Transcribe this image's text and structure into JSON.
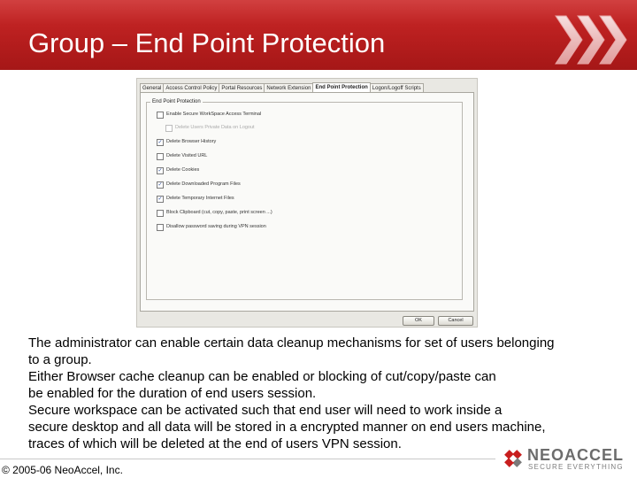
{
  "slide": {
    "title": "Group – End Point Protection",
    "accent_color": "#b71e1e"
  },
  "dialog": {
    "tabs": [
      {
        "label": "General",
        "active": false
      },
      {
        "label": "Access Control Policy",
        "active": false
      },
      {
        "label": "Portal Resources",
        "active": false
      },
      {
        "label": "Network Extension",
        "active": false
      },
      {
        "label": "End Point Protection",
        "active": true
      },
      {
        "label": "Logon/Logoff Scripts",
        "active": false
      }
    ],
    "group_title": "End Point Protection",
    "options": [
      {
        "label": "Enable Secure WorkSpace Access Terminal",
        "checked": false
      },
      {
        "label": "Delete Users Private Data on Logout",
        "checked": false,
        "disabled": true
      },
      {
        "label": "Delete Browser History",
        "checked": true
      },
      {
        "label": "Delete Visited URL",
        "checked": false
      },
      {
        "label": "Delete Cookies",
        "checked": true
      },
      {
        "label": "Delete Downloaded Program Files",
        "checked": true
      },
      {
        "label": "Delete Temporary Internet Files",
        "checked": true
      },
      {
        "label": "Block Clipboard (cut, copy, paste, print screen ...)",
        "checked": false
      },
      {
        "label": "Disallow password saving during VPN session",
        "checked": false
      }
    ],
    "ok_label": "OK",
    "cancel_label": "Cancel"
  },
  "body_text": [
    "The administrator can enable certain data cleanup mechanisms for set of users belonging",
    "to a group.",
    "Either Browser cache cleanup can be enabled or blocking of cut/copy/paste can",
    "be enabled for the duration of end users session.",
    "Secure workspace can be activated such that end user will need to work inside a",
    "secure desktop and all data will be stored in a encrypted manner on end users machine,",
    "traces of which will be deleted at the end of users VPN session."
  ],
  "footer": {
    "copyright": "© 2005-06 NeoAccel, Inc.",
    "logo_name": "NEOACCEL",
    "logo_tagline": "SECURE EVERYTHING"
  },
  "icons": {
    "header_decoration": "triple-chevron-icon",
    "logo_mark": "neoaccel-logo-icon",
    "checkbox_checked": "checkmark-icon"
  }
}
